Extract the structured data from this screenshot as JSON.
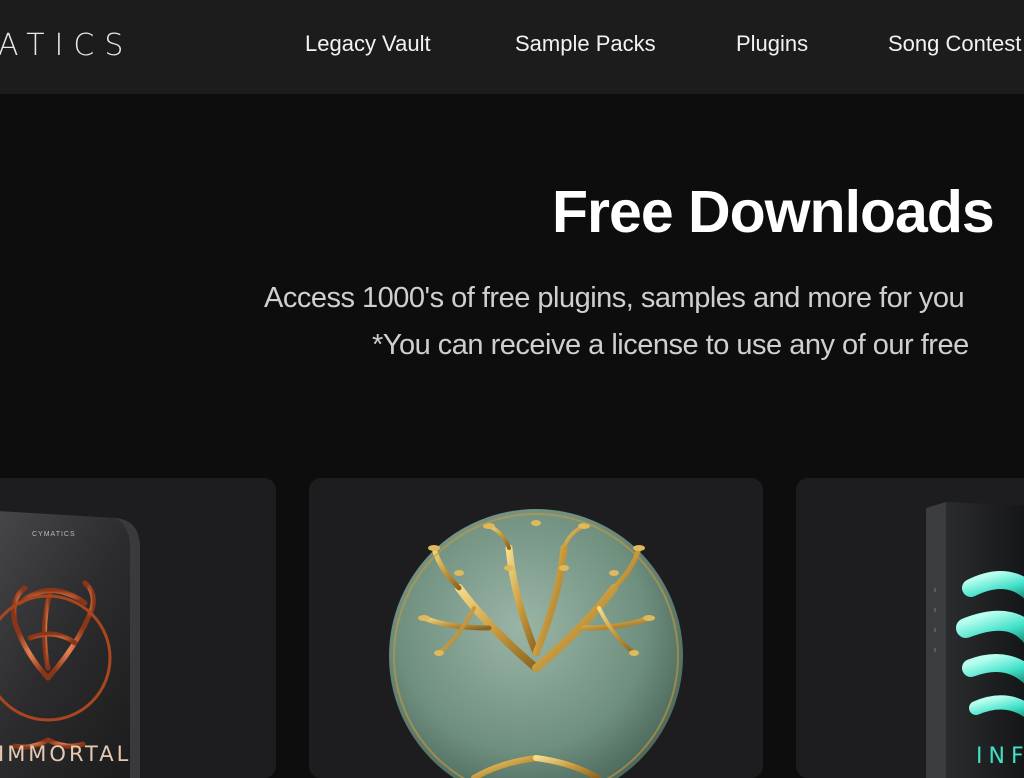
{
  "header": {
    "logo_text": "ATICS",
    "nav": [
      {
        "label": "Legacy Vault"
      },
      {
        "label": "Sample Packs"
      },
      {
        "label": "Plugins"
      },
      {
        "label": "Song Contest"
      }
    ]
  },
  "hero": {
    "title": "Free Downloads",
    "line1": "Access 1000's of free plugins, samples and more for you",
    "line2": "*You can receive a license to use any of our free"
  },
  "cards": [
    {
      "icon": "immortal-product-box",
      "box_brand": "CYMATICS",
      "box_title": "IMMORTAL"
    },
    {
      "icon": "tree-of-life-emblem"
    },
    {
      "icon": "infinity-product-box",
      "box_title": "INFI"
    }
  ],
  "colors": {
    "header_bg": "#1c1c1d",
    "page_bg": "#0d0d0e",
    "card_bg": "#1d1d1f",
    "emblem_green": "#7e9c8c",
    "gold": "#d7b15b",
    "copper": "#c4643a",
    "teal": "#3fe0c8"
  }
}
